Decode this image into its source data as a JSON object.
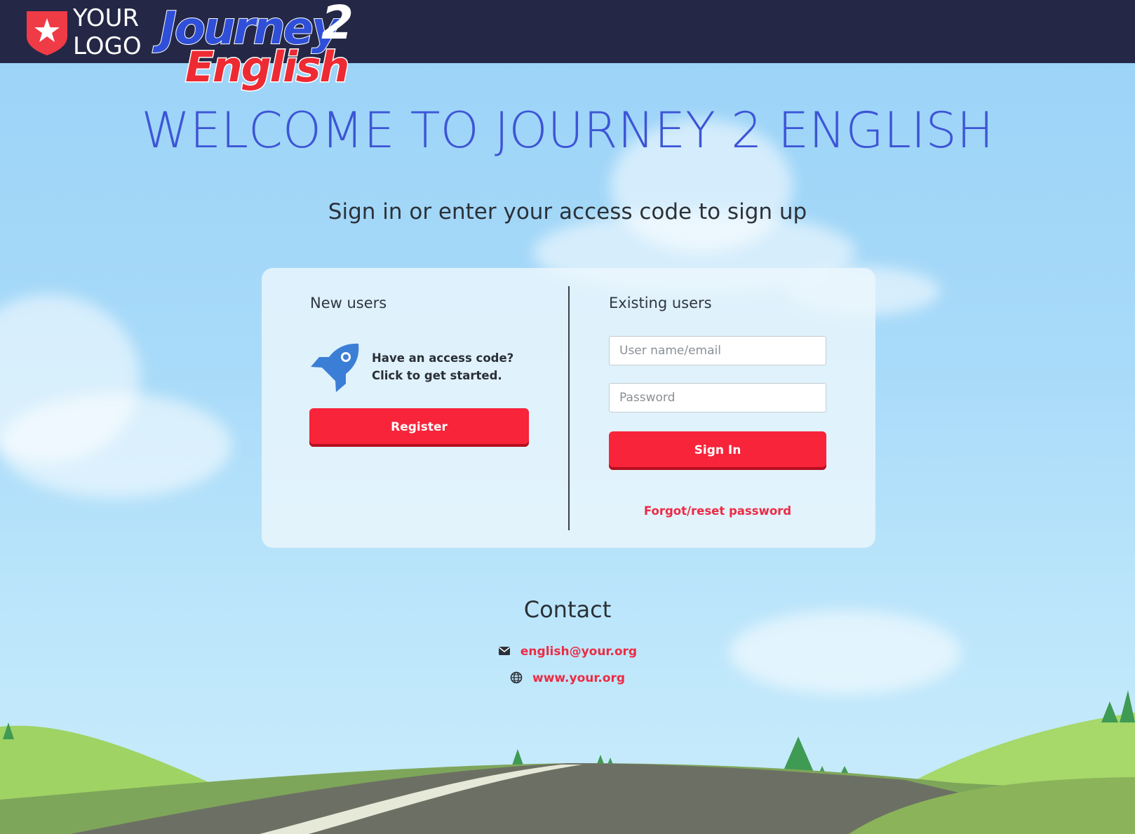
{
  "header": {
    "logo_line1": "YOUR",
    "logo_line2": "LOGO",
    "brand_line1": "Journey",
    "brand_number": "2",
    "brand_line2": "English"
  },
  "hero": {
    "title": "WELCOME TO JOURNEY 2 ENGLISH",
    "subtitle": "Sign in or enter your access code to sign up"
  },
  "new_users": {
    "heading": "New users",
    "icon": "rocket-icon",
    "prompt_line1": "Have an access code?",
    "prompt_line2": "Click to get started.",
    "register_label": "Register"
  },
  "existing_users": {
    "heading": "Existing users",
    "username_placeholder": "User name/email",
    "username_value": "",
    "password_placeholder": "Password",
    "password_value": "",
    "signin_label": "Sign In",
    "forgot_label": "Forgot/reset password"
  },
  "contact": {
    "heading": "Contact",
    "email": "english@your.org",
    "email_icon": "envelope-icon",
    "website": "www.your.org",
    "website_icon": "globe-icon"
  },
  "colors": {
    "topbar": "#242846",
    "accent_red": "#f7243a",
    "title_blue": "#3d55d6",
    "link_red": "#ec2b44",
    "sky": "#a9dbf9"
  }
}
